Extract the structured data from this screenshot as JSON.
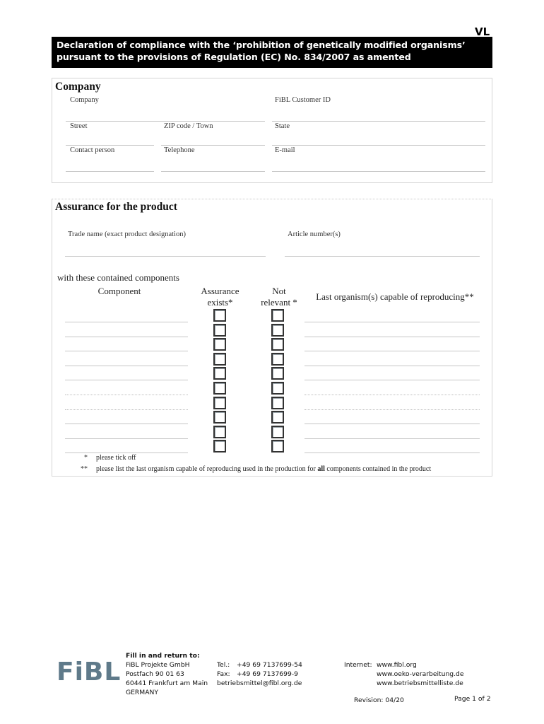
{
  "document": {
    "code": "VL",
    "title_line1": "Declaration of compliance with the ‘prohibition of genetically modified organisms’",
    "title_line2": "pursuant to the provisions of Regulation (EC) No. 834/2007 as amented"
  },
  "company": {
    "heading": "Company",
    "fields": {
      "company": {
        "label": "Company",
        "value": ""
      },
      "customer_id": {
        "label": "FiBL Customer ID",
        "value": ""
      },
      "street": {
        "label": "Street",
        "value": ""
      },
      "zip_town": {
        "label": "ZIP code / Town",
        "value": ""
      },
      "state": {
        "label": "State",
        "value": ""
      },
      "contact_person": {
        "label": "Contact person",
        "value": ""
      },
      "telephone": {
        "label": "Telephone",
        "value": ""
      },
      "email": {
        "label": "E-mail",
        "value": ""
      }
    }
  },
  "assurance": {
    "heading": "Assurance for the product",
    "trade_name_label": "Trade name (exact product designation)",
    "article_number_label": "Article number(s)",
    "components_caption": "with these contained components",
    "columns": {
      "component": "Component",
      "assurance_exists_1": "Assurance",
      "assurance_exists_2": "exists*",
      "not_relevant_1": "Not",
      "not_relevant_2": "relevant *",
      "last_organism": "Last organism(s) capable of reproducing**"
    },
    "rows": [
      {
        "component": "",
        "assurance_exists": false,
        "not_relevant": false,
        "last_organism": ""
      },
      {
        "component": "",
        "assurance_exists": false,
        "not_relevant": false,
        "last_organism": ""
      },
      {
        "component": "",
        "assurance_exists": false,
        "not_relevant": false,
        "last_organism": ""
      },
      {
        "component": "",
        "assurance_exists": false,
        "not_relevant": false,
        "last_organism": ""
      },
      {
        "component": "",
        "assurance_exists": false,
        "not_relevant": false,
        "last_organism": ""
      },
      {
        "component": "",
        "assurance_exists": false,
        "not_relevant": false,
        "last_organism": ""
      },
      {
        "component": "",
        "assurance_exists": false,
        "not_relevant": false,
        "last_organism": ""
      },
      {
        "component": "",
        "assurance_exists": false,
        "not_relevant": false,
        "last_organism": ""
      },
      {
        "component": "",
        "assurance_exists": false,
        "not_relevant": false,
        "last_organism": ""
      },
      {
        "component": "",
        "assurance_exists": false,
        "not_relevant": false,
        "last_organism": ""
      }
    ],
    "footnotes": [
      {
        "mark": "*",
        "text_before": "please tick off",
        "bold": "",
        "text_after": ""
      },
      {
        "mark": "**",
        "text_before": "please list the last organism capable of reproducing used in the production for ",
        "bold": "all",
        "text_after": " components contained in the product"
      }
    ]
  },
  "footer": {
    "logo_text": "FiBL",
    "return_heading": "Fill in and return to:",
    "address": [
      "FiBL Projekte GmbH",
      "Postfach 90 01 63",
      "60441 Frankfurt am Main",
      "GERMANY"
    ],
    "tel_label": "Tel.:",
    "tel": "+49 69 7137699-54",
    "fax_label": "Fax:",
    "fax": "+49 69 7137699-9",
    "email": "betriebsmittel@fibl.org.de",
    "internet_label": "Internet:",
    "websites": [
      "www.fibl.org",
      "www.oeko-verarbeitung.de",
      "www.betriebsmittelliste.de"
    ],
    "revision": "Revision: 04/20",
    "page": "Page 1 of 2"
  }
}
